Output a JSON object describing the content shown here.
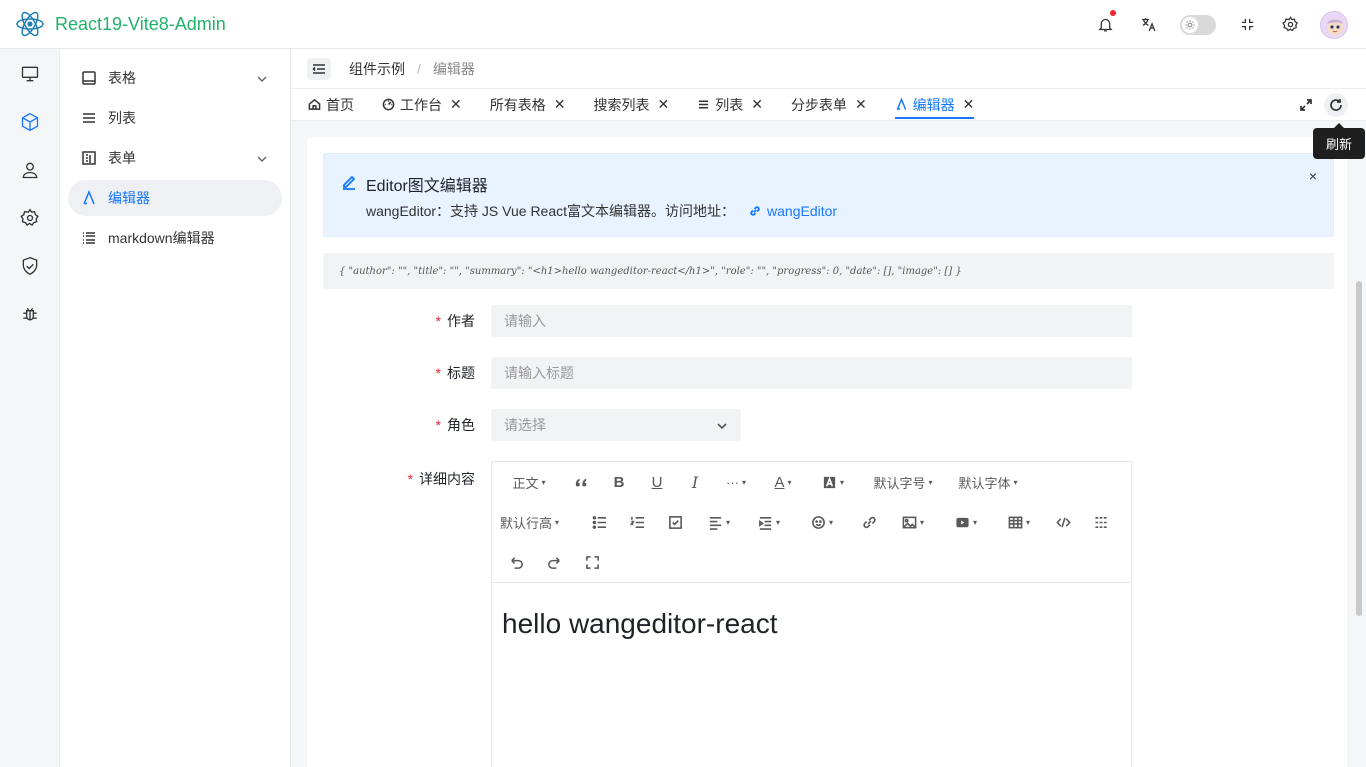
{
  "app": {
    "title": "React19-Vite8-Admin",
    "brand_color": "#21b26a",
    "accent_color": "#1677ff"
  },
  "header": {
    "icons": [
      "bell-icon",
      "translate-icon",
      "theme-toggle",
      "fullscreen-icon",
      "gear-icon",
      "avatar"
    ]
  },
  "rail": {
    "items": [
      {
        "icon": "monitor-icon",
        "active": false
      },
      {
        "icon": "cube-icon",
        "active": true
      },
      {
        "icon": "user-icon",
        "active": false
      },
      {
        "icon": "gear-icon",
        "active": false
      },
      {
        "icon": "shield-icon",
        "active": false
      },
      {
        "icon": "bug-icon",
        "active": false
      }
    ]
  },
  "submenu": {
    "items": [
      {
        "label": "表格",
        "icon": "table-icon",
        "has_children": true
      },
      {
        "label": "列表",
        "icon": "list-icon",
        "has_children": false
      },
      {
        "label": "表单",
        "icon": "form-icon",
        "has_children": true
      },
      {
        "label": "编辑器",
        "icon": "editor-icon",
        "has_children": false,
        "active": true
      },
      {
        "label": "markdown编辑器",
        "icon": "markdown-list-icon",
        "has_children": false
      }
    ]
  },
  "breadcrumb": {
    "parent": "组件示例",
    "separator": "/",
    "current": "编辑器"
  },
  "tabs": [
    {
      "label": "首页",
      "icon": "home-icon",
      "closable": false
    },
    {
      "label": "工作台",
      "icon": "dashboard-icon",
      "closable": true
    },
    {
      "label": "所有表格",
      "closable": true
    },
    {
      "label": "搜索列表",
      "closable": true
    },
    {
      "label": "列表",
      "icon": "list-icon",
      "closable": true
    },
    {
      "label": "分步表单",
      "closable": true
    },
    {
      "label": "编辑器",
      "icon": "editor-icon",
      "closable": true,
      "active": true
    }
  ],
  "tab_close_glyph": "✕",
  "tooltip": {
    "refresh": "刷新"
  },
  "alert": {
    "title": "Editor图文编辑器",
    "description": "wangEditor：支持 JS Vue React富文本编辑器。访问地址：",
    "link_text": "wangEditor",
    "close": "×"
  },
  "json_preview": "{ \"author\": \"\", \"title\": \"\", \"summary\": \"<h1>hello wangeditor-react</h1>\", \"role\": \"\", \"progress\": 0, \"date\": [], \"image\": [] }",
  "form": {
    "required_mark": "*",
    "author": {
      "label": "作者",
      "placeholder": "请输入"
    },
    "title": {
      "label": "标题",
      "placeholder": "请输入标题"
    },
    "role": {
      "label": "角色",
      "placeholder": "请选择"
    },
    "content": {
      "label": "详细内容"
    }
  },
  "editor": {
    "toolbar_text": {
      "paragraph": "正文",
      "font_size": "默认字号",
      "font_family": "默认字体",
      "line_height": "默认行高",
      "more": "···",
      "bold": "B",
      "underline": "U",
      "italic": "I",
      "font_color": "A",
      "dropdown": "▾"
    },
    "content": "hello wangeditor-react"
  }
}
